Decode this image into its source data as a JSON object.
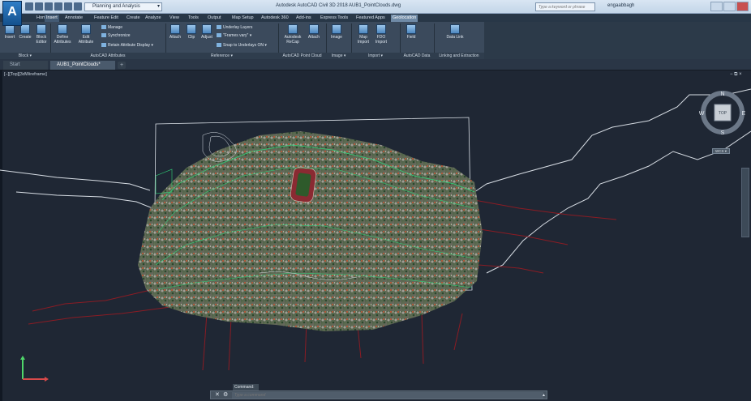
{
  "app": {
    "logo": "A",
    "title": "Autodesk AutoCAD Civil 3D 2018    AUB1_PointClouds.dwg"
  },
  "quick_access": {
    "workspace": "Planning and Analysis"
  },
  "search": {
    "placeholder": "Type a keyword or phrase"
  },
  "user": {
    "name": "engaabbagh"
  },
  "ribbon_tabs": [
    "Home",
    "Insert",
    "Annotate",
    "Feature Edit",
    "Create",
    "Analyze",
    "View",
    "Tools",
    "Output",
    "Map Setup",
    "Autodesk 360",
    "Add-ins",
    "Express Tools",
    "Featured Apps",
    "Geolocation"
  ],
  "ribbon": {
    "block": {
      "insert": "Insert",
      "create": "Create",
      "block_editor": "Block Editor",
      "panel": "Block ▾"
    },
    "attributes": {
      "define": "Define Attributes",
      "edit": "Edit Attribute",
      "manage": "Manage",
      "synchronize": "Synchronize",
      "retain": "Retain Attribute Display ▾",
      "panel": "AutoCAD Attributes"
    },
    "reference": {
      "attach": "Attach",
      "clip": "Clip",
      "adjust": "Adjust",
      "underlay_layers": "Underlay Layers",
      "frames": "\"Frames vary\" ▾",
      "snap": "Snap to Underlays ON ▾",
      "panel": "Reference ▾"
    },
    "point_cloud": {
      "recap": "Autodesk ReCap",
      "attach": "Attach",
      "panel": "AutoCAD Point Cloud"
    },
    "image": {
      "image": "Image",
      "panel": "Image ▾"
    },
    "import": {
      "map_import": "Map Import",
      "fdo_import": "FDO Import",
      "panel": "Import ▾"
    },
    "data": {
      "field": "Field",
      "panel": "AutoCAD Data"
    },
    "linking": {
      "data_link": "Data Link",
      "panel": "Linking and Extraction"
    }
  },
  "doc_tabs": [
    "Start",
    "AUB1_PointClouds*"
  ],
  "viewport": {
    "label": "[−][Top][3dWireframe]",
    "controls": "− ⧉ ×"
  },
  "viewcube": {
    "north": "N",
    "south": "S",
    "east": "E",
    "west": "W",
    "face": "TOP",
    "wcs": "WCS ▾"
  },
  "command": {
    "history": "Command:",
    "placeholder": "Type a command"
  },
  "colors": {
    "drawing_bg": "#1f2734",
    "ribbon_bg": "#3b4a5c",
    "boundary": "#2fd67a",
    "roads": "#8b1c24",
    "outline": "#d7dde4"
  }
}
